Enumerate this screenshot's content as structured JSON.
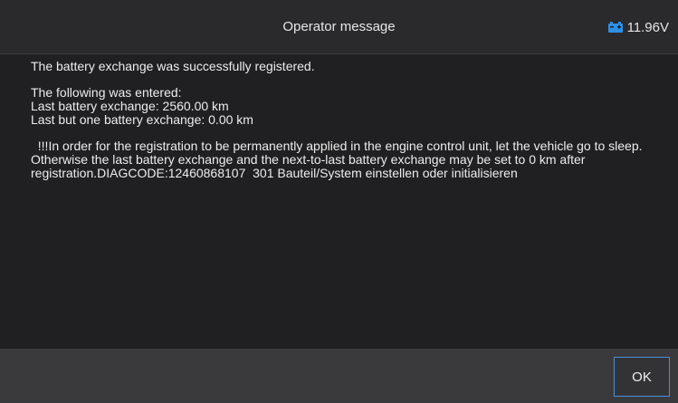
{
  "header": {
    "title": "Operator message",
    "voltage": "11.96V",
    "battery_icon": "car-battery-icon",
    "accent_color": "#2f8fe6"
  },
  "message": {
    "line1": "The battery exchange was successfully registered.",
    "line2": "The following was entered:",
    "line3": "Last battery exchange: 2560.00 km",
    "line4": "Last but one battery exchange: 0.00 km",
    "line5": "  !!!In order for the registration to be permanently applied in the engine control unit, let the vehicle go to sleep. Otherwise the last battery exchange and the next-to-last battery exchange may be set to 0 km after registration.DIAGCODE:12460868107  301 Bauteil/System einstellen oder initialisieren"
  },
  "footer": {
    "ok_label": "OK",
    "button_border_color": "#4a8fd9"
  }
}
